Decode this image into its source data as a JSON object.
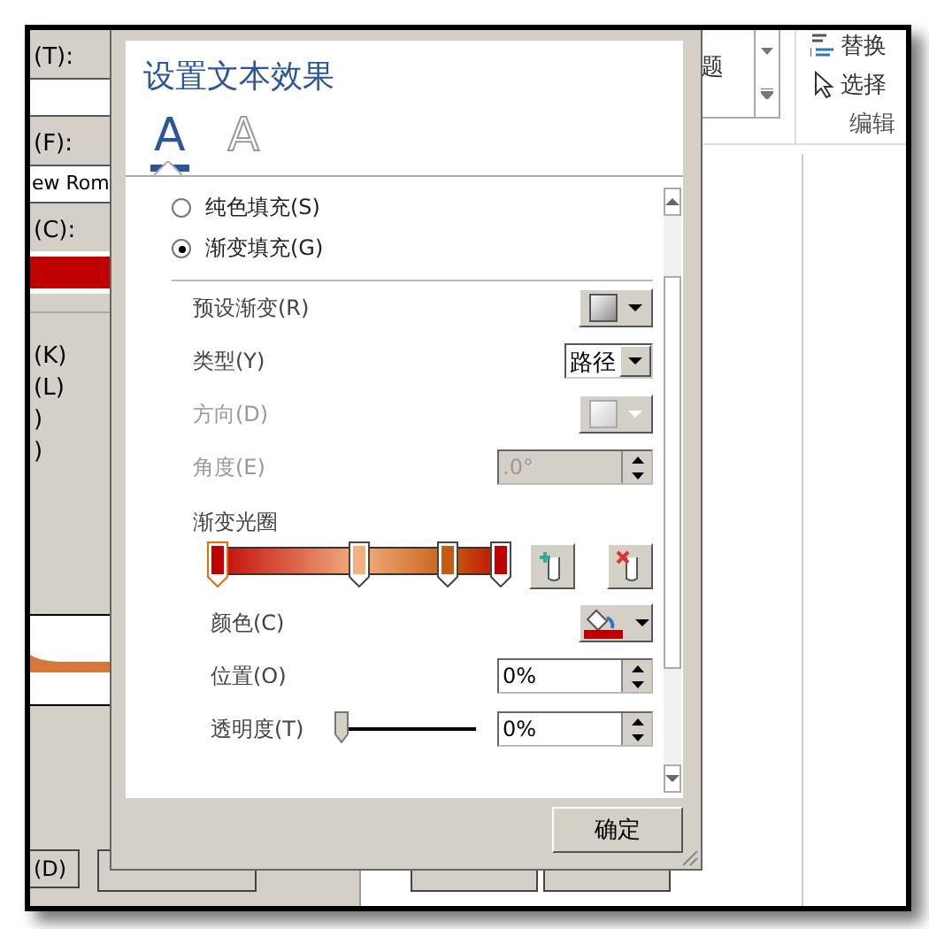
{
  "background_dialog": {
    "fields": [
      {
        "kind": "text",
        "label": "(T):"
      },
      {
        "kind": "text",
        "label": "(F):",
        "value": "ew Rom"
      },
      {
        "kind": "color",
        "label": "(C):"
      }
    ],
    "options": [
      "(K)",
      "(L)",
      ")",
      ")"
    ],
    "buttons": [
      "(D)"
    ]
  },
  "ribbon": {
    "gallery_text": "题",
    "items": [
      {
        "kind": "replace",
        "label": "替换"
      },
      {
        "kind": "select",
        "label": "选择"
      }
    ],
    "group": "编辑"
  },
  "dialog": {
    "title": "设置文本效果",
    "tabs": [
      {
        "glyph": "A",
        "selected": true
      },
      {
        "glyph": "A",
        "selected": false
      }
    ],
    "fill_options": [
      {
        "label": "纯色填充(S)",
        "selected": false
      },
      {
        "label": "渐变填充(G)",
        "selected": true
      }
    ],
    "rows": [
      {
        "kind": "dropdown",
        "label": "预设渐变(R)",
        "disabled": false
      },
      {
        "kind": "combo",
        "label": "类型(Y)",
        "value": "路径",
        "disabled": false
      },
      {
        "kind": "dropdown",
        "label": "方向(D)",
        "disabled": true
      },
      {
        "kind": "spin",
        "label": "角度(E)",
        "value": ".0°",
        "disabled": true
      }
    ],
    "gradient_stops": {
      "label": "渐变光圈",
      "items": [
        {
          "color": "#c00000",
          "level": 0,
          "selected": true
        },
        {
          "color": "#f2b07f",
          "level": 0.5,
          "selected": false
        },
        {
          "color": "#c55a11",
          "level": 0.81,
          "selected": false
        },
        {
          "color": "#c00000",
          "level": 1,
          "selected": false
        }
      ]
    },
    "stop_rows": [
      {
        "kind": "color",
        "label": "颜色(C)"
      },
      {
        "kind": "spin",
        "label": "位置(O)",
        "value": "0%"
      },
      {
        "kind": "slider",
        "label": "透明度(T)",
        "level": 0,
        "value": "0%"
      }
    ],
    "ok_button": "确定"
  }
}
